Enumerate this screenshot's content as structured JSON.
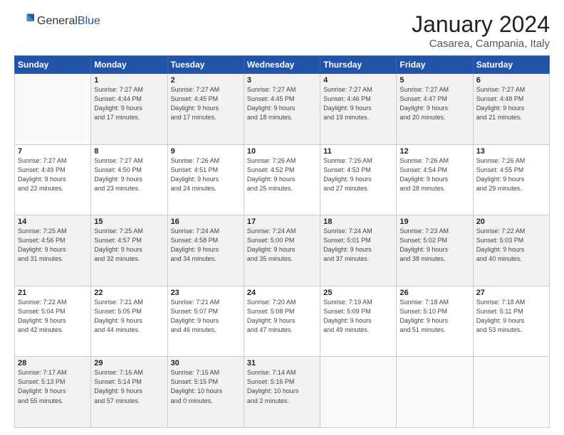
{
  "header": {
    "logo_general": "General",
    "logo_blue": "Blue",
    "month_title": "January 2024",
    "location": "Casarea, Campania, Italy"
  },
  "weekdays": [
    "Sunday",
    "Monday",
    "Tuesday",
    "Wednesday",
    "Thursday",
    "Friday",
    "Saturday"
  ],
  "weeks": [
    [
      {
        "day": "",
        "info": ""
      },
      {
        "day": "1",
        "info": "Sunrise: 7:27 AM\nSunset: 4:44 PM\nDaylight: 9 hours\nand 17 minutes."
      },
      {
        "day": "2",
        "info": "Sunrise: 7:27 AM\nSunset: 4:45 PM\nDaylight: 9 hours\nand 17 minutes."
      },
      {
        "day": "3",
        "info": "Sunrise: 7:27 AM\nSunset: 4:45 PM\nDaylight: 9 hours\nand 18 minutes."
      },
      {
        "day": "4",
        "info": "Sunrise: 7:27 AM\nSunset: 4:46 PM\nDaylight: 9 hours\nand 19 minutes."
      },
      {
        "day": "5",
        "info": "Sunrise: 7:27 AM\nSunset: 4:47 PM\nDaylight: 9 hours\nand 20 minutes."
      },
      {
        "day": "6",
        "info": "Sunrise: 7:27 AM\nSunset: 4:48 PM\nDaylight: 9 hours\nand 21 minutes."
      }
    ],
    [
      {
        "day": "7",
        "info": "Sunrise: 7:27 AM\nSunset: 4:49 PM\nDaylight: 9 hours\nand 22 minutes."
      },
      {
        "day": "8",
        "info": "Sunrise: 7:27 AM\nSunset: 4:50 PM\nDaylight: 9 hours\nand 23 minutes."
      },
      {
        "day": "9",
        "info": "Sunrise: 7:26 AM\nSunset: 4:51 PM\nDaylight: 9 hours\nand 24 minutes."
      },
      {
        "day": "10",
        "info": "Sunrise: 7:26 AM\nSunset: 4:52 PM\nDaylight: 9 hours\nand 25 minutes."
      },
      {
        "day": "11",
        "info": "Sunrise: 7:26 AM\nSunset: 4:53 PM\nDaylight: 9 hours\nand 27 minutes."
      },
      {
        "day": "12",
        "info": "Sunrise: 7:26 AM\nSunset: 4:54 PM\nDaylight: 9 hours\nand 28 minutes."
      },
      {
        "day": "13",
        "info": "Sunrise: 7:26 AM\nSunset: 4:55 PM\nDaylight: 9 hours\nand 29 minutes."
      }
    ],
    [
      {
        "day": "14",
        "info": "Sunrise: 7:25 AM\nSunset: 4:56 PM\nDaylight: 9 hours\nand 31 minutes."
      },
      {
        "day": "15",
        "info": "Sunrise: 7:25 AM\nSunset: 4:57 PM\nDaylight: 9 hours\nand 32 minutes."
      },
      {
        "day": "16",
        "info": "Sunrise: 7:24 AM\nSunset: 4:58 PM\nDaylight: 9 hours\nand 34 minutes."
      },
      {
        "day": "17",
        "info": "Sunrise: 7:24 AM\nSunset: 5:00 PM\nDaylight: 9 hours\nand 35 minutes."
      },
      {
        "day": "18",
        "info": "Sunrise: 7:24 AM\nSunset: 5:01 PM\nDaylight: 9 hours\nand 37 minutes."
      },
      {
        "day": "19",
        "info": "Sunrise: 7:23 AM\nSunset: 5:02 PM\nDaylight: 9 hours\nand 38 minutes."
      },
      {
        "day": "20",
        "info": "Sunrise: 7:22 AM\nSunset: 5:03 PM\nDaylight: 9 hours\nand 40 minutes."
      }
    ],
    [
      {
        "day": "21",
        "info": "Sunrise: 7:22 AM\nSunset: 5:04 PM\nDaylight: 9 hours\nand 42 minutes."
      },
      {
        "day": "22",
        "info": "Sunrise: 7:21 AM\nSunset: 5:05 PM\nDaylight: 9 hours\nand 44 minutes."
      },
      {
        "day": "23",
        "info": "Sunrise: 7:21 AM\nSunset: 5:07 PM\nDaylight: 9 hours\nand 46 minutes."
      },
      {
        "day": "24",
        "info": "Sunrise: 7:20 AM\nSunset: 5:08 PM\nDaylight: 9 hours\nand 47 minutes."
      },
      {
        "day": "25",
        "info": "Sunrise: 7:19 AM\nSunset: 5:09 PM\nDaylight: 9 hours\nand 49 minutes."
      },
      {
        "day": "26",
        "info": "Sunrise: 7:18 AM\nSunset: 5:10 PM\nDaylight: 9 hours\nand 51 minutes."
      },
      {
        "day": "27",
        "info": "Sunrise: 7:18 AM\nSunset: 5:11 PM\nDaylight: 9 hours\nand 53 minutes."
      }
    ],
    [
      {
        "day": "28",
        "info": "Sunrise: 7:17 AM\nSunset: 5:13 PM\nDaylight: 9 hours\nand 55 minutes."
      },
      {
        "day": "29",
        "info": "Sunrise: 7:16 AM\nSunset: 5:14 PM\nDaylight: 9 hours\nand 57 minutes."
      },
      {
        "day": "30",
        "info": "Sunrise: 7:15 AM\nSunset: 5:15 PM\nDaylight: 10 hours\nand 0 minutes."
      },
      {
        "day": "31",
        "info": "Sunrise: 7:14 AM\nSunset: 5:16 PM\nDaylight: 10 hours\nand 2 minutes."
      },
      {
        "day": "",
        "info": ""
      },
      {
        "day": "",
        "info": ""
      },
      {
        "day": "",
        "info": ""
      }
    ]
  ]
}
